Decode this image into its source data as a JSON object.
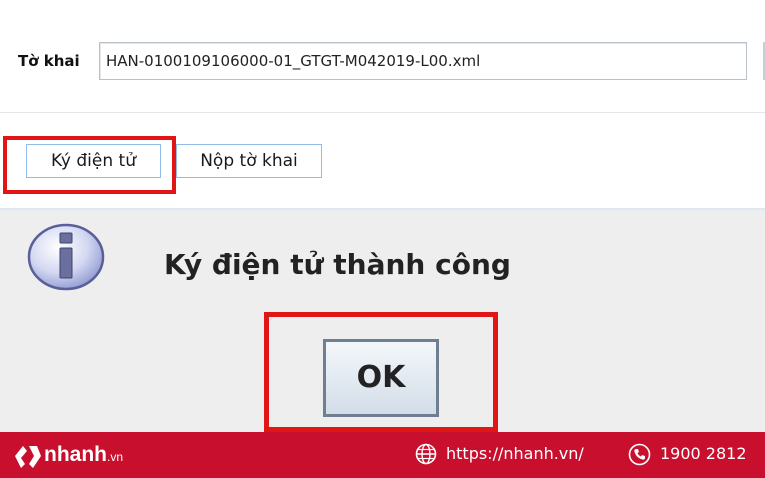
{
  "form": {
    "file_label": "Tờ khai",
    "file_value": "HAN-0100109106000-01_GTGT-M042019-L00.xml"
  },
  "toolbar": {
    "sign_label": "Ký điện tử",
    "submit_label": "Nộp tờ khai"
  },
  "dialog": {
    "icon": "info-icon",
    "message": "Ký điện tử thành công",
    "ok_label": "OK"
  },
  "footer": {
    "brand": "nhanh",
    "brand_suffix": ".vn",
    "url": "https://nhanh.vn/",
    "phone": "1900 2812",
    "background_color": "#c8102e"
  },
  "highlight_color": "#e01515"
}
